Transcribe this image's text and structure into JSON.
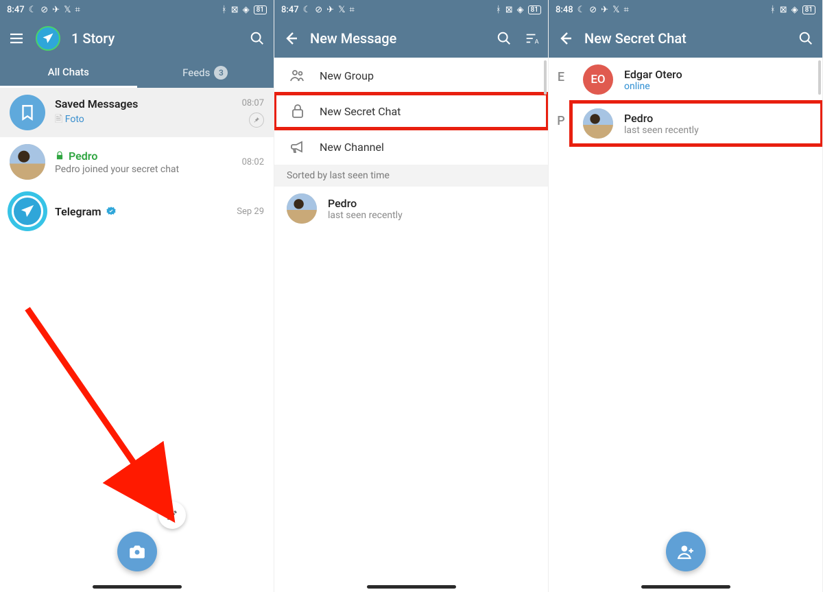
{
  "statusbar": {
    "time1": "8:47",
    "time2": "8:47",
    "time3": "8:48",
    "battery": "81"
  },
  "screen1": {
    "title": "1 Story",
    "tabs": {
      "all": "All Chats",
      "feeds": "Feeds",
      "feeds_count": "3"
    },
    "chats": [
      {
        "name": "Saved Messages",
        "sub_prefix": "",
        "sub_link": "Foto",
        "time": "08:07",
        "pinned": true
      },
      {
        "name": "Pedro",
        "sub": "Pedro joined your secret chat",
        "time": "08:02",
        "secret": true
      },
      {
        "name": "Telegram",
        "sub": "",
        "time": "Sep 29",
        "verified": true
      }
    ]
  },
  "screen2": {
    "title": "New Message",
    "options": [
      {
        "label": "New Group",
        "icon": "group"
      },
      {
        "label": "New Secret Chat",
        "icon": "lock",
        "highlight": true
      },
      {
        "label": "New Channel",
        "icon": "megaphone"
      }
    ],
    "sort_header": "Sorted by last seen time",
    "contacts": [
      {
        "name": "Pedro",
        "status": "last seen recently"
      }
    ]
  },
  "screen3": {
    "title": "New Secret Chat",
    "groups": [
      {
        "letter": "E",
        "contacts": [
          {
            "name": "Edgar Otero",
            "status": "online",
            "online": true,
            "initials": "EO"
          }
        ]
      },
      {
        "letter": "P",
        "contacts": [
          {
            "name": "Pedro",
            "status": "last seen recently",
            "highlight": true
          }
        ]
      }
    ]
  }
}
